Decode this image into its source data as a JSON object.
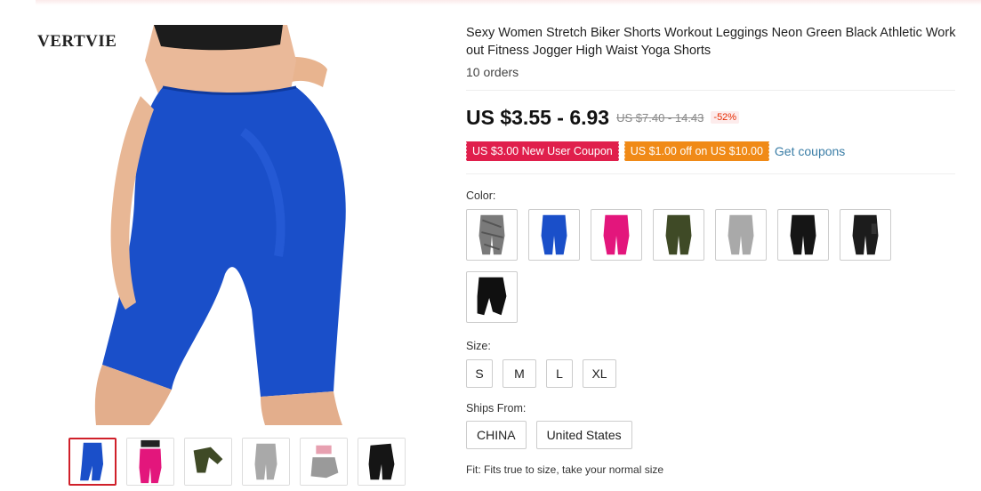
{
  "gallery": {
    "brand": "VERTVIE",
    "main_image_color": "#1a4fc9",
    "thumbnails": [
      {
        "name": "thumb-blue",
        "color": "#1a4fc9",
        "active": true
      },
      {
        "name": "thumb-pink",
        "color": "#e3167c",
        "active": false
      },
      {
        "name": "thumb-olive",
        "color": "#3f4a26",
        "active": false
      },
      {
        "name": "thumb-gray",
        "color": "#a9a9a9",
        "active": false
      },
      {
        "name": "thumb-gray-pink-top",
        "color": "#9a9a9a",
        "active": false
      },
      {
        "name": "thumb-black",
        "color": "#151515",
        "active": false
      }
    ]
  },
  "product": {
    "title": "Sexy Women Stretch Biker Shorts Workout Leggings Neon Green Black Athletic Work out Fitness Jogger High Waist Yoga Shorts",
    "orders": "10 orders"
  },
  "price": {
    "current": "US $3.55 - 6.93",
    "original": "US $7.40 - 14.43",
    "discount": "-52%"
  },
  "coupons": {
    "new_user": "US $3.00 New User Coupon",
    "store": "US $1.00 off on US $10.00",
    "get_link": "Get coupons"
  },
  "colors": {
    "label": "Color:",
    "options": [
      "#7a7a7a",
      "#1a4fc9",
      "#e3167c",
      "#3f4a26",
      "#a9a9a9",
      "#151515",
      "#1c1c1c",
      "#101010"
    ]
  },
  "sizes": {
    "label": "Size:",
    "options": [
      "S",
      "M",
      "L",
      "XL"
    ]
  },
  "ships": {
    "label": "Ships From:",
    "options": [
      "CHINA",
      "United States"
    ]
  },
  "fit": "Fit: Fits true to size, take your normal size",
  "accent": {
    "red": "#e01f4c",
    "orange": "#f08a17",
    "link": "#3a7da6"
  }
}
